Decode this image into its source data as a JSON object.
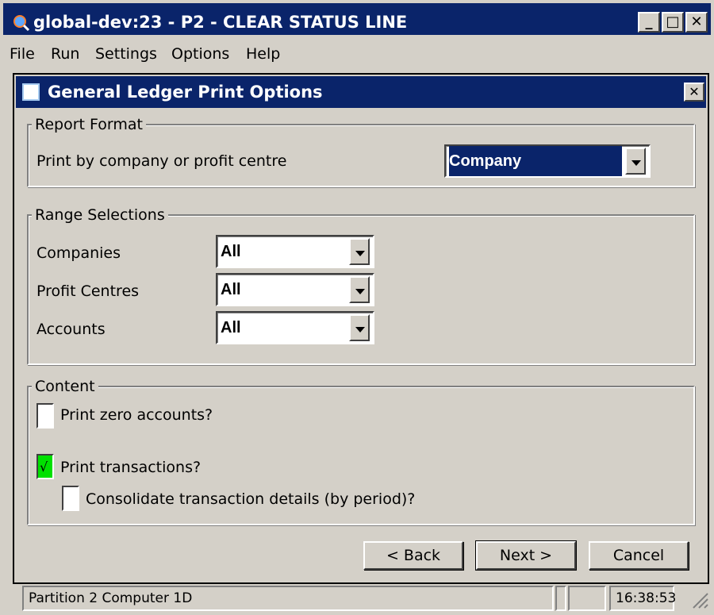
{
  "window": {
    "title": "global-dev:23 - P2 - CLEAR STATUS LINE",
    "minimize_label": "_",
    "maximize_label": "□",
    "close_label": "✕"
  },
  "menu": {
    "items": [
      "File",
      "Run",
      "Settings",
      "Options",
      "Help"
    ]
  },
  "dialog": {
    "title": "General Ledger Print Options",
    "close_label": "✕",
    "report_format": {
      "legend": "Report Format",
      "print_by_label": "Print by company or profit centre",
      "print_by_value": "Company"
    },
    "range_selections": {
      "legend": "Range Selections",
      "companies_label": "Companies",
      "companies_value": "All",
      "profit_centres_label": "Profit Centres",
      "profit_centres_value": "All",
      "accounts_label": "Accounts",
      "accounts_value": "All"
    },
    "content": {
      "legend": "Content",
      "print_zero_label": "Print zero accounts?",
      "print_zero_checked": false,
      "print_transactions_label": "Print transactions?",
      "print_transactions_checked": true,
      "print_transactions_mark": "√",
      "consolidate_label": "Consolidate transaction details (by period)?",
      "consolidate_checked": false
    },
    "buttons": {
      "back": "< Back",
      "next": "Next >",
      "cancel": "Cancel"
    }
  },
  "statusbar": {
    "partition": "Partition 2 Computer 1D",
    "time": "16:38:53"
  },
  "colors": {
    "titlebar": "#0a246a",
    "face": "#d4d0c8",
    "checked_box": "#00e000"
  }
}
